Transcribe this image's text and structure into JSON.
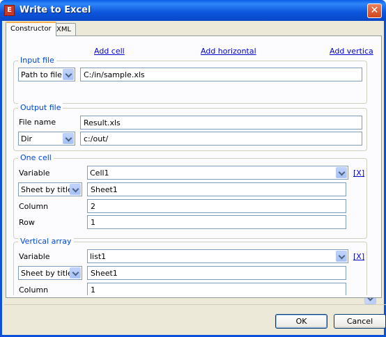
{
  "window": {
    "title": "Write to Excel",
    "icon": "app-excel-icon",
    "close_glyph": "✕"
  },
  "tabs": [
    {
      "label": "Constructor",
      "active": true
    },
    {
      "label": "XML",
      "active": false
    }
  ],
  "links": {
    "add_cell": "Add cell",
    "add_horizontal": "Add horizontal",
    "add_vertical": "Add vertica"
  },
  "input_file": {
    "legend": "Input file",
    "mode": "Path to file",
    "path": "C:/in/sample.xls"
  },
  "output_file": {
    "legend": "Output file",
    "file_name_label": "File name",
    "file_name": "Result.xls",
    "mode": "Dir",
    "path": "c:/out/"
  },
  "one_cell": {
    "legend": "One cell",
    "variable_label": "Variable",
    "variable": "Cell1",
    "remove": "[X]",
    "sheet_mode": "Sheet by title",
    "sheet": "Sheet1",
    "column_label": "Column",
    "column": "2",
    "row_label": "Row",
    "row": "1"
  },
  "vertical_array": {
    "legend": "Vertical array",
    "variable_label": "Variable",
    "variable": "list1",
    "remove": "[X]",
    "sheet_mode": "Sheet by title",
    "sheet": "Sheet1",
    "column_label": "Column",
    "column": "1"
  },
  "buttons": {
    "ok": "OK",
    "cancel": "Cancel"
  },
  "colors": {
    "titlebar": "#0a50d8",
    "legend": "#0046d5",
    "link": "#0000cc",
    "face": "#ece9d8"
  }
}
